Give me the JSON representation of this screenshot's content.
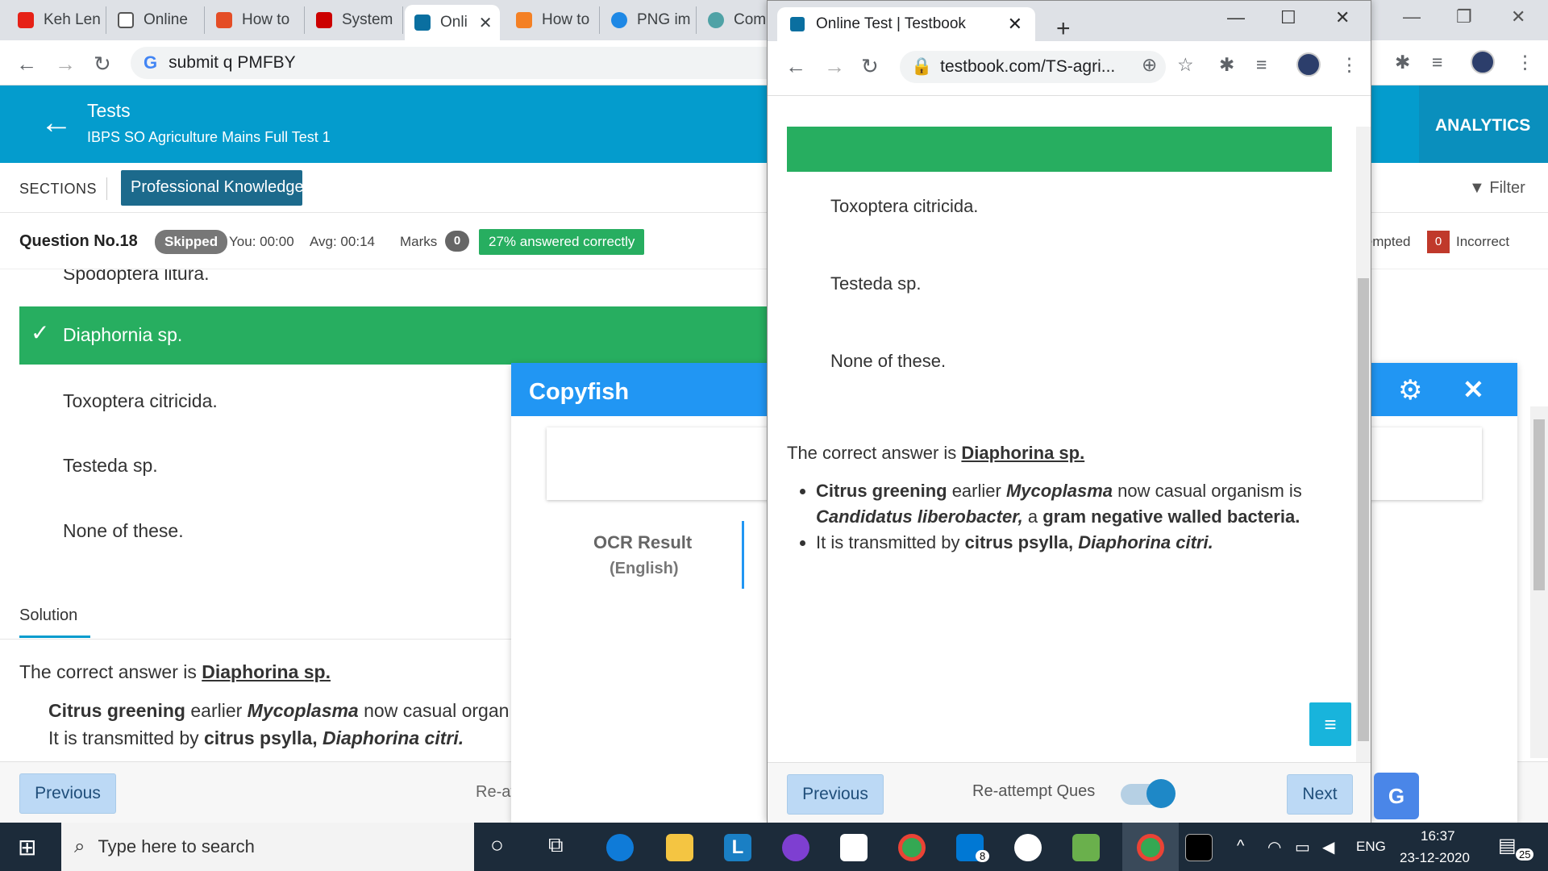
{
  "browser": {
    "tabs": [
      {
        "label": "Keh Len",
        "color": "#e62117"
      },
      {
        "label": "Online",
        "color": "#555555"
      },
      {
        "label": "How to",
        "color": "#e44d26"
      },
      {
        "label": "System",
        "color": "#cc0000"
      },
      {
        "label": "Onli",
        "color": "#0a6fa0"
      },
      {
        "label": "How to",
        "color": "#f48024"
      },
      {
        "label": "PNG im",
        "color": "#1e88e5"
      },
      {
        "label": "Comp",
        "color": "#4fa2a6"
      }
    ],
    "close_glyph": "✕",
    "address": "submit  q PMFBY"
  },
  "header": {
    "title": "Tests",
    "subtitle": "IBPS SO Agriculture Mains Full Test 1",
    "analytics": "ANALYTICS"
  },
  "sections": {
    "label": "SECTIONS",
    "active": "Professional Knowledge",
    "filter": "Filter"
  },
  "question": {
    "number_label": "Question No.18",
    "status": "Skipped",
    "you": "You: 00:00",
    "avg": "Avg: 00:14",
    "marks_label": "Marks",
    "marks_value": "0",
    "answered_pct": "27% answered correctly",
    "attempted_label": "Attempted",
    "incorrect_count": "0",
    "incorrect_label": "Incorrect"
  },
  "options": {
    "partial": "Spodoptera litura.",
    "correct": "Diaphornia sp.",
    "o2": "Toxoptera citricida.",
    "o3": "Testeda sp.",
    "o4": "None of these."
  },
  "solution": {
    "tab": "Solution",
    "prefix": "The correct answer is ",
    "answer": "Diaphorina sp.",
    "b1_bold1": "Citrus greening",
    "b1_t1": " earlier ",
    "b1_it1": "Mycoplasma",
    "b1_t2": " now casual organism is ",
    "b1_it2": "Candidatus liberobacter,",
    "b1_t3": " a ",
    "b1_bold2": "gram negative walled bacteria.",
    "b2_t1": "It is transmitted by ",
    "b2_bold": "citrus psylla, ",
    "b2_it": "Diaphorina citri."
  },
  "bottom": {
    "previous": "Previous",
    "reattempt": "Re-attempt Ques",
    "next": "Next"
  },
  "copyfish": {
    "title": "Copyfish",
    "ocr_result": "OCR Result",
    "ocr_lang": "(English)"
  },
  "popup": {
    "tab_title": "Online Test | Testbook",
    "url": "testbook.com/TS-agri...",
    "options": [
      "Toxoptera citricida.",
      "Testeda sp.",
      "None of these."
    ]
  },
  "taskbar": {
    "search_placeholder": "Type here to search",
    "lang": "ENG",
    "time": "16:37",
    "date": "23-12-2020",
    "mail_badge": "8",
    "notif_count": "25"
  }
}
